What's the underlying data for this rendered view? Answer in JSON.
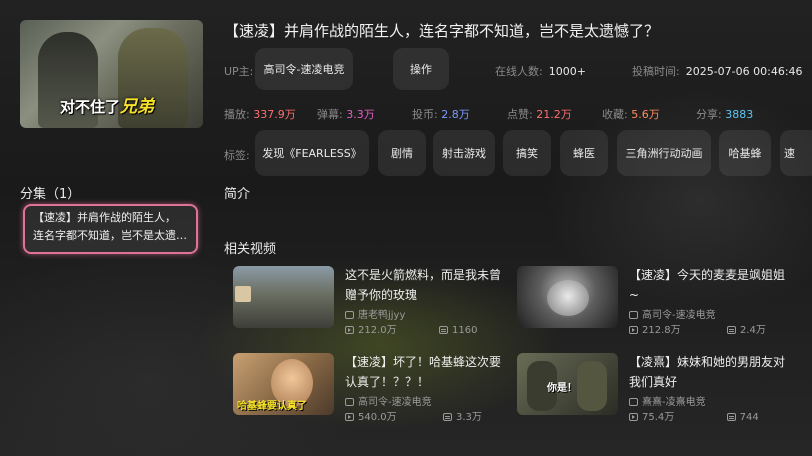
{
  "video": {
    "title": "【速凌】并肩作战的陌生人，连名字都不知道，岂不是太遗憾了？",
    "cover_caption_white": "对不住了",
    "cover_caption_yellow": "兄弟",
    "uploader_label": "UP主:",
    "uploader_name": "高司令-速凌电竞",
    "operation_label": "操作",
    "online_label": "在线人数:",
    "online_value": "1000+",
    "pubtime_label": "投稿时间:",
    "pubtime_value": "2025-07-06 00:46:46"
  },
  "stats": [
    {
      "label": "播放:",
      "value": "337.9万",
      "color": "#ff6f6f"
    },
    {
      "label": "弹幕:",
      "value": "3.3万",
      "color": "#e35ec9"
    },
    {
      "label": "投币:",
      "value": "2.8万",
      "color": "#7c9bff"
    },
    {
      "label": "点赞:",
      "value": "21.2万",
      "color": "#ff6f6f"
    },
    {
      "label": "收藏:",
      "value": "5.6万",
      "color": "#ff8f5c"
    },
    {
      "label": "分享:",
      "value": "3883",
      "color": "#5ec8f5"
    }
  ],
  "tags_label": "标签:",
  "tags": [
    "发现《FEARLESS》",
    "剧情",
    "射击游戏",
    "搞笑",
    "蜂医",
    "三角洲行动动画",
    "哈基蜂",
    "速"
  ],
  "episodes": {
    "heading": "分集（1）",
    "items": [
      {
        "line1": "【速凌】并肩作战的陌生人，",
        "line2": "连名字都不知道，岂不是太遗憾了？"
      }
    ]
  },
  "intro_heading": "简介",
  "related_heading": "相关视频",
  "related": [
    {
      "title": "这不是火箭燃料，而是我未曾赠予你的玫瑰",
      "author": "唐老鸭jjyy",
      "plays": "212.0万",
      "danmaku": "1160",
      "badge": ""
    },
    {
      "title": "【速凌】今天的麦麦是飒姐姐~",
      "author": "高司令-速凌电竞",
      "plays": "212.8万",
      "danmaku": "2.4万",
      "badge": ""
    },
    {
      "title": "【速凌】坏了！哈基蜂这次要认真了！？？！",
      "author": "高司令-速凌电竞",
      "plays": "540.0万",
      "danmaku": "3.3万",
      "badge": "哈基蜂要认真了"
    },
    {
      "title": "【凌熹】妹妹和她的男朋友对我们真好",
      "author": "熹熹-凌熹电竞",
      "plays": "75.4万",
      "danmaku": "744",
      "badge": "你是！"
    }
  ]
}
